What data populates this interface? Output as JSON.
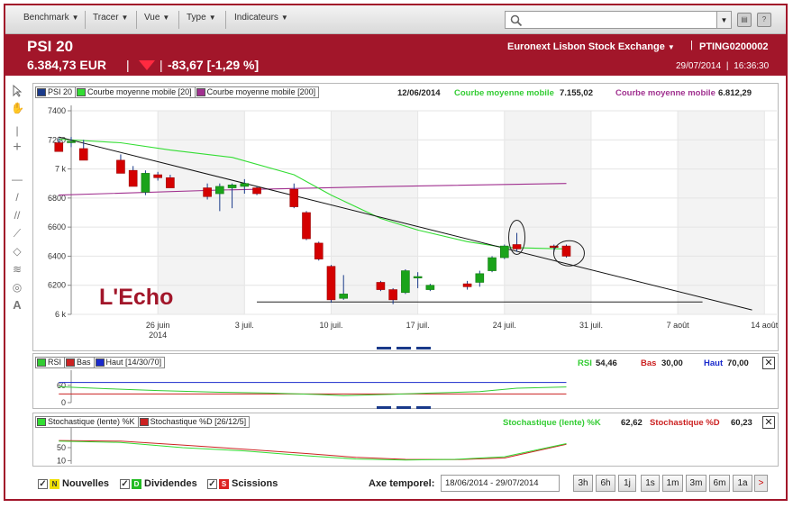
{
  "toolbar": {
    "menus": [
      {
        "label": "Benchmark"
      },
      {
        "label": "Tracer"
      },
      {
        "label": "Vue"
      },
      {
        "label": "Type"
      },
      {
        "label": "Indicateurs"
      }
    ],
    "search_value": ""
  },
  "header": {
    "name": "PSI 20",
    "price": "6.384,73 EUR",
    "change": "-83,67  [-1,29 %]",
    "exchange": "Euronext Lisbon Stock Exchange",
    "code": "PTING0200002",
    "date": "29/07/2014",
    "time": "16:36:30",
    "pipe": "|"
  },
  "colors": {
    "brand": "#a2162a",
    "candle_up": "#1aa31a",
    "candle_down": "#d40000",
    "ma20": "#33dd33",
    "ma200": "#a0308f",
    "rsi": "#33cc33",
    "stoch_k": "#33dd33",
    "stoch_d": "#cc2222"
  },
  "main_chart": {
    "legend": [
      "PSI 20",
      "Courbe moyenne mobile  [20]",
      "Courbe moyenne mobile  [200]"
    ],
    "readout_date": "12/06/2014",
    "readout_ma20_label": "Courbe moyenne mobile",
    "readout_ma20_value": "7.155,02",
    "readout_ma200_label": "Courbe moyenne mobile",
    "readout_ma200_value": "6.812,29",
    "watermark": "L'Echo"
  },
  "chart_data": [
    {
      "type": "candlestick",
      "title": "PSI 20",
      "ylim": [
        6000,
        7400
      ],
      "y_ticks": [
        {
          "v": 7400,
          "label": "7400"
        },
        {
          "v": 7200,
          "label": "7200"
        },
        {
          "v": 7000,
          "label": "7 k"
        },
        {
          "v": 6800,
          "label": "6800"
        },
        {
          "v": 6600,
          "label": "6600"
        },
        {
          "v": 6400,
          "label": "6400"
        },
        {
          "v": 6200,
          "label": "6200"
        },
        {
          "v": 6000,
          "label": "6 k"
        }
      ],
      "x_range": [
        "2014-06-19",
        "2014-08-15"
      ],
      "x_ticks": [
        {
          "date": "2014-06-26",
          "label": "26 juin",
          "sub": "2014"
        },
        {
          "date": "2014-07-03",
          "label": "3 juil."
        },
        {
          "date": "2014-07-10",
          "label": "10 juil."
        },
        {
          "date": "2014-07-17",
          "label": "17 juil."
        },
        {
          "date": "2014-07-24",
          "label": "24 juil."
        },
        {
          "date": "2014-07-31",
          "label": "31 juil."
        },
        {
          "date": "2014-08-07",
          "label": "7 août"
        },
        {
          "date": "2014-08-14",
          "label": "14 août"
        }
      ],
      "candles": [
        {
          "date": "2014-06-18",
          "o": 7180,
          "h": 7210,
          "l": 7120,
          "c": 7120
        },
        {
          "date": "2014-06-19",
          "o": 7190,
          "h": 7220,
          "l": 7150,
          "c": 7190
        },
        {
          "date": "2014-06-20",
          "o": 7140,
          "h": 7200,
          "l": 7060,
          "c": 7060
        },
        {
          "date": "2014-06-23",
          "o": 7060,
          "h": 7100,
          "l": 6970,
          "c": 6970
        },
        {
          "date": "2014-06-24",
          "o": 6990,
          "h": 7020,
          "l": 6880,
          "c": 6880
        },
        {
          "date": "2014-06-25",
          "o": 6840,
          "h": 6990,
          "l": 6820,
          "c": 6970
        },
        {
          "date": "2014-06-26",
          "o": 6960,
          "h": 6980,
          "l": 6920,
          "c": 6940
        },
        {
          "date": "2014-06-27",
          "o": 6940,
          "h": 6960,
          "l": 6870,
          "c": 6870
        },
        {
          "date": "2014-06-30",
          "o": 6870,
          "h": 6900,
          "l": 6790,
          "c": 6810
        },
        {
          "date": "2014-07-01",
          "o": 6830,
          "h": 6900,
          "l": 6710,
          "c": 6880
        },
        {
          "date": "2014-07-02",
          "o": 6870,
          "h": 6900,
          "l": 6730,
          "c": 6890
        },
        {
          "date": "2014-07-03",
          "o": 6880,
          "h": 6930,
          "l": 6830,
          "c": 6900
        },
        {
          "date": "2014-07-04",
          "o": 6870,
          "h": 6880,
          "l": 6820,
          "c": 6830
        },
        {
          "date": "2014-07-07",
          "o": 6860,
          "h": 6900,
          "l": 6730,
          "c": 6740
        },
        {
          "date": "2014-07-08",
          "o": 6700,
          "h": 6710,
          "l": 6510,
          "c": 6520
        },
        {
          "date": "2014-07-09",
          "o": 6490,
          "h": 6500,
          "l": 6370,
          "c": 6380
        },
        {
          "date": "2014-07-10",
          "o": 6330,
          "h": 6340,
          "l": 6080,
          "c": 6100
        },
        {
          "date": "2014-07-11",
          "o": 6110,
          "h": 6270,
          "l": 6100,
          "c": 6140
        },
        {
          "date": "2014-07-14",
          "o": 6220,
          "h": 6230,
          "l": 6160,
          "c": 6170
        },
        {
          "date": "2014-07-15",
          "o": 6170,
          "h": 6180,
          "l": 6070,
          "c": 6100
        },
        {
          "date": "2014-07-16",
          "o": 6150,
          "h": 6310,
          "l": 6140,
          "c": 6300
        },
        {
          "date": "2014-07-17",
          "o": 6250,
          "h": 6290,
          "l": 6180,
          "c": 6260
        },
        {
          "date": "2014-07-18",
          "o": 6170,
          "h": 6210,
          "l": 6160,
          "c": 6200
        },
        {
          "date": "2014-07-21",
          "o": 6210,
          "h": 6230,
          "l": 6170,
          "c": 6190
        },
        {
          "date": "2014-07-22",
          "o": 6220,
          "h": 6300,
          "l": 6190,
          "c": 6280
        },
        {
          "date": "2014-07-23",
          "o": 6300,
          "h": 6400,
          "l": 6290,
          "c": 6390
        },
        {
          "date": "2014-07-24",
          "o": 6390,
          "h": 6480,
          "l": 6380,
          "c": 6470
        },
        {
          "date": "2014-07-25",
          "o": 6480,
          "h": 6560,
          "l": 6430,
          "c": 6450
        },
        {
          "date": "2014-07-28",
          "o": 6470,
          "h": 6480,
          "l": 6430,
          "c": 6460
        },
        {
          "date": "2014-07-29",
          "o": 6470,
          "h": 6480,
          "l": 6390,
          "c": 6400
        }
      ],
      "ma20": [
        {
          "date": "2014-06-18",
          "v": 7205
        },
        {
          "date": "2014-06-23",
          "v": 7180
        },
        {
          "date": "2014-06-27",
          "v": 7130
        },
        {
          "date": "2014-07-02",
          "v": 7080
        },
        {
          "date": "2014-07-07",
          "v": 6960
        },
        {
          "date": "2014-07-10",
          "v": 6820
        },
        {
          "date": "2014-07-14",
          "v": 6660
        },
        {
          "date": "2014-07-17",
          "v": 6580
        },
        {
          "date": "2014-07-21",
          "v": 6500
        },
        {
          "date": "2014-07-24",
          "v": 6460
        },
        {
          "date": "2014-07-29",
          "v": 6450
        }
      ],
      "ma200": [
        {
          "date": "2014-06-18",
          "v": 6820
        },
        {
          "date": "2014-07-01",
          "v": 6855
        },
        {
          "date": "2014-07-15",
          "v": 6880
        },
        {
          "date": "2014-07-29",
          "v": 6900
        }
      ],
      "trendline": [
        {
          "date": "2014-06-18",
          "v": 7220
        },
        {
          "date": "2014-08-13",
          "v": 6030
        }
      ],
      "support_line": [
        {
          "date": "2014-07-04",
          "v": 6085
        },
        {
          "date": "2014-08-09",
          "v": 6085
        }
      ]
    },
    {
      "type": "line",
      "title": "RSI",
      "legend": [
        "RSI",
        "Bas",
        "Haut [14/30/70]"
      ],
      "ylim": [
        0,
        100
      ],
      "y_ticks": [
        60,
        0
      ],
      "levels": {
        "bas": 30,
        "haut": 70
      },
      "series": [
        {
          "name": "RSI",
          "points": [
            {
              "date": "2014-06-18",
              "v": 55
            },
            {
              "date": "2014-06-22",
              "v": 48
            },
            {
              "date": "2014-06-26",
              "v": 42
            },
            {
              "date": "2014-07-01",
              "v": 36
            },
            {
              "date": "2014-07-05",
              "v": 33
            },
            {
              "date": "2014-07-09",
              "v": 28
            },
            {
              "date": "2014-07-11",
              "v": 24
            },
            {
              "date": "2014-07-15",
              "v": 29
            },
            {
              "date": "2014-07-18",
              "v": 33
            },
            {
              "date": "2014-07-22",
              "v": 38
            },
            {
              "date": "2014-07-25",
              "v": 50
            },
            {
              "date": "2014-07-29",
              "v": 54.46
            }
          ]
        }
      ],
      "readout": {
        "rsi_label": "RSI",
        "rsi_value": "54,46",
        "bas_label": "Bas",
        "bas_value": "30,00",
        "haut_label": "Haut",
        "haut_value": "70,00"
      }
    },
    {
      "type": "line",
      "title": "Stochastique",
      "legend": [
        "Stochastique (lente) %K",
        "Stochastique %D [26/12/5]"
      ],
      "ylim": [
        0,
        100
      ],
      "y_ticks": [
        50,
        10
      ],
      "series": [
        {
          "name": "Stochastique (lente) %K",
          "points": [
            {
              "date": "2014-06-18",
              "v": 70
            },
            {
              "date": "2014-06-23",
              "v": 66
            },
            {
              "date": "2014-06-28",
              "v": 50
            },
            {
              "date": "2014-07-03",
              "v": 40
            },
            {
              "date": "2014-07-08",
              "v": 25
            },
            {
              "date": "2014-07-12",
              "v": 15
            },
            {
              "date": "2014-07-16",
              "v": 12
            },
            {
              "date": "2014-07-20",
              "v": 14
            },
            {
              "date": "2014-07-24",
              "v": 22
            },
            {
              "date": "2014-07-29",
              "v": 62.62
            }
          ]
        },
        {
          "name": "Stochastique %D",
          "points": [
            {
              "date": "2014-06-18",
              "v": 72
            },
            {
              "date": "2014-06-23",
              "v": 70
            },
            {
              "date": "2014-06-28",
              "v": 58
            },
            {
              "date": "2014-07-03",
              "v": 45
            },
            {
              "date": "2014-07-08",
              "v": 32
            },
            {
              "date": "2014-07-12",
              "v": 20
            },
            {
              "date": "2014-07-16",
              "v": 14
            },
            {
              "date": "2014-07-20",
              "v": 13
            },
            {
              "date": "2014-07-24",
              "v": 18
            },
            {
              "date": "2014-07-29",
              "v": 60.23
            }
          ]
        }
      ],
      "readout": {
        "k_label": "Stochastique (lente) %K",
        "k_value": "62,62",
        "d_label": "Stochastique %D",
        "d_value": "60,23"
      }
    }
  ],
  "footer": {
    "checks": [
      {
        "tag": "N",
        "label": "Nouvelles",
        "color": "#f0e000"
      },
      {
        "tag": "D",
        "label": "Dividendes",
        "color": "#22bb22"
      },
      {
        "tag": "S",
        "label": "Scissions",
        "color": "#dd2222"
      }
    ],
    "axe_label": "Axe temporel:",
    "axe_value": "18/06/2014 - 29/07/2014",
    "periods": [
      "3h",
      "6h",
      "1j",
      "1s",
      "1m",
      "3m",
      "6m",
      "1a"
    ],
    "next": ">"
  },
  "tools": [
    "cursor",
    "hand",
    "vertical-line",
    "crosshair",
    "horizontal-line",
    "trend-line",
    "parallel-lines",
    "ray-line",
    "channel",
    "fibonacci-fan",
    "fibonacci-arc",
    "text"
  ]
}
